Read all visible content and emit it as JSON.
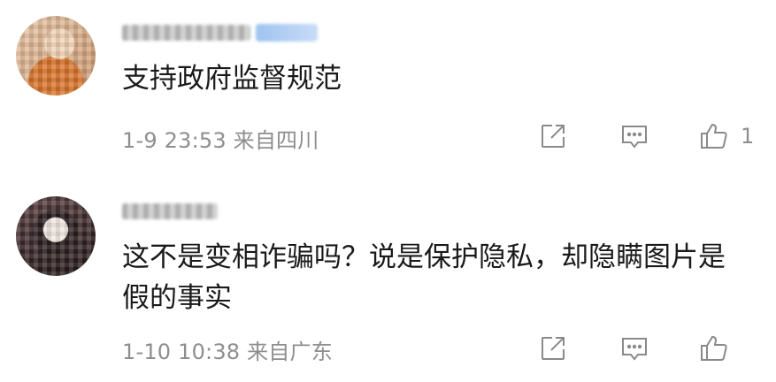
{
  "comments": [
    {
      "username": "",
      "content": "支持政府监督规范",
      "time": "1-9 23:53",
      "location": "来自四川",
      "likes": "1"
    },
    {
      "username": "",
      "content": "这不是变相诈骗吗？说是保护隐私，却隐瞒图片是假的事实",
      "time": "1-10 10:38",
      "location": "来自广东",
      "likes": ""
    }
  ],
  "icons": {
    "share": "share-icon",
    "reply": "comment-icon",
    "like": "thumbs-up-icon"
  },
  "colors": {
    "text": "#1a1a1a",
    "meta": "#8e8e8e",
    "icon": "#8a8a8a"
  }
}
